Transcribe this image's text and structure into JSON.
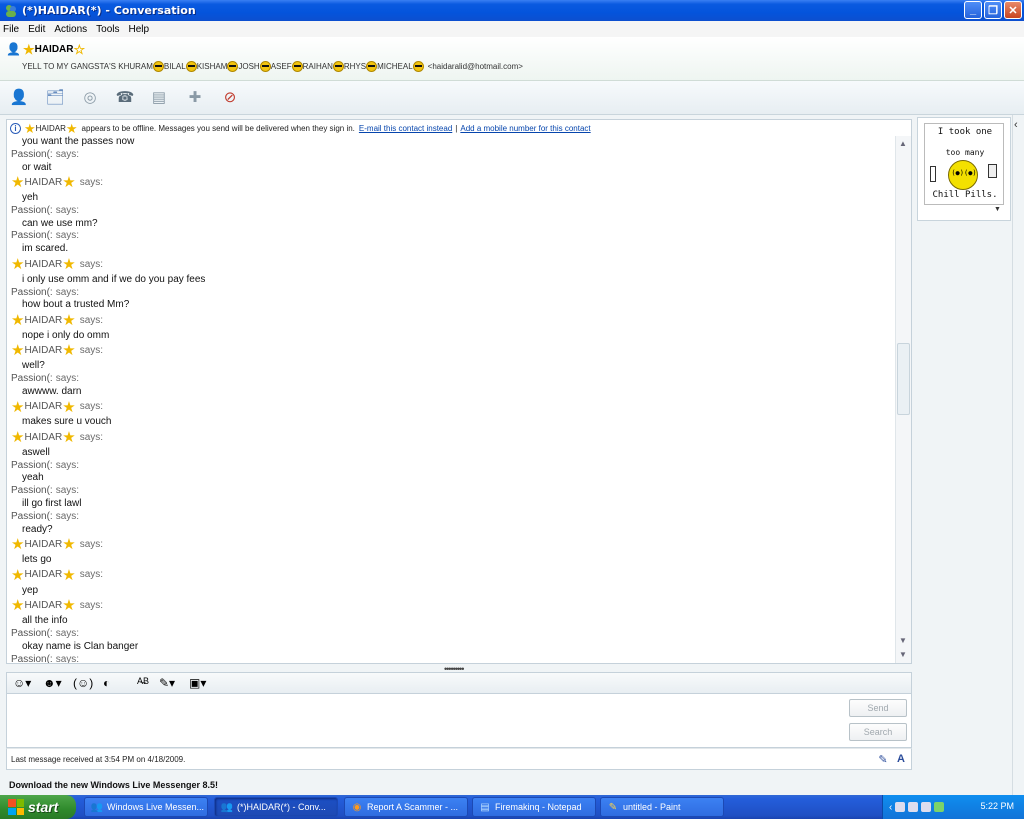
{
  "window": {
    "title": "(*)HAIDAR(*) - Conversation"
  },
  "menu": [
    "File",
    "Edit",
    "Actions",
    "Tools",
    "Help"
  ],
  "contact": {
    "display_name": "HAIDAR",
    "personal_message_parts": [
      "YELL TO MY GANGSTA'S KHURAM",
      "BILAL",
      "KISHAM",
      "JOSH",
      "ASEF",
      "RAIHAN",
      "RHYS",
      "MICHEAL",
      "<haidaralid@hotmail.com>"
    ]
  },
  "toolbar_icons": [
    "invite-icon",
    "share-files-icon",
    "video-call-icon",
    "call-icon",
    "games-icon",
    "activities-icon",
    "block-icon"
  ],
  "infobar": {
    "name": "HAIDAR",
    "text": "appears to be offline. Messages you send will be delivered when they sign in.",
    "link_email": "E-mail this contact instead",
    "separator": "|",
    "link_mobile": "Add a mobile number for this contact"
  },
  "conversation": [
    {
      "type": "msg",
      "text": "you want the passes now"
    },
    {
      "type": "says",
      "who": "Passion(:",
      "label": "says:"
    },
    {
      "type": "msg",
      "text": "or wait"
    },
    {
      "type": "says_h",
      "who": "HAIDAR",
      "label": "says:"
    },
    {
      "type": "msg",
      "text": "yeh"
    },
    {
      "type": "says",
      "who": "Passion(:",
      "label": "says:"
    },
    {
      "type": "msg",
      "text": "can we use mm?"
    },
    {
      "type": "says",
      "who": "Passion(:",
      "label": "says:"
    },
    {
      "type": "msg",
      "text": "im scared."
    },
    {
      "type": "says_h",
      "who": "HAIDAR",
      "label": "says:"
    },
    {
      "type": "msg",
      "text": "i only use omm and if we do you pay fees"
    },
    {
      "type": "says",
      "who": "Passion(:",
      "label": "says:"
    },
    {
      "type": "msg",
      "text": "how bout a trusted Mm?"
    },
    {
      "type": "says_h",
      "who": "HAIDAR",
      "label": "says:"
    },
    {
      "type": "msg",
      "text": "nope i only do omm"
    },
    {
      "type": "says_h",
      "who": "HAIDAR",
      "label": "says:"
    },
    {
      "type": "msg",
      "text": "well?"
    },
    {
      "type": "says",
      "who": "Passion(:",
      "label": "says:"
    },
    {
      "type": "msg",
      "text": "awwww. darn"
    },
    {
      "type": "says_h",
      "who": "HAIDAR",
      "label": "says:"
    },
    {
      "type": "msg",
      "text": "makes sure u vouch"
    },
    {
      "type": "says_h",
      "who": "HAIDAR",
      "label": "says:"
    },
    {
      "type": "msg",
      "text": "aswell"
    },
    {
      "type": "says",
      "who": "Passion(:",
      "label": "says:"
    },
    {
      "type": "msg",
      "text": "yeah"
    },
    {
      "type": "says",
      "who": "Passion(:",
      "label": "says:"
    },
    {
      "type": "msg",
      "text": "ill go first lawl"
    },
    {
      "type": "says",
      "who": "Passion(:",
      "label": "says:"
    },
    {
      "type": "msg",
      "text": "ready?"
    },
    {
      "type": "says_h",
      "who": "HAIDAR",
      "label": "says:"
    },
    {
      "type": "msg",
      "text": "lets go"
    },
    {
      "type": "says_h",
      "who": "HAIDAR",
      "label": "says:"
    },
    {
      "type": "msg",
      "text": "yep"
    },
    {
      "type": "says_h",
      "who": "HAIDAR",
      "label": "says:"
    },
    {
      "type": "msg",
      "text": "all the info"
    },
    {
      "type": "says",
      "who": "Passion(:",
      "label": "says:"
    },
    {
      "type": "msg",
      "text": "okay name is Clan banger"
    },
    {
      "type": "says",
      "who": "Passion(:",
      "label": "says:"
    }
  ],
  "input": {
    "send_label": "Send",
    "search_label": "Search",
    "value": ""
  },
  "status": {
    "last_message": "Last message received at 3:54 PM on 4/18/2009."
  },
  "download_banner": "Download the new Windows Live Messenger 8.5!",
  "display_picture": {
    "line1": "I took one",
    "line2": "too many",
    "line3": "Chill Pills."
  },
  "taskbar": {
    "start_label": "start",
    "tasks": [
      {
        "label": "Windows Live Messen...",
        "icon": "messenger-icon"
      },
      {
        "label": "(*)HAIDAR(*) - Conv...",
        "icon": "conversation-icon"
      },
      {
        "label": "Report A Scammer - ...",
        "icon": "firefox-icon"
      },
      {
        "label": "Firemakinq - Notepad",
        "icon": "notepad-icon"
      },
      {
        "label": "untitled - Paint",
        "icon": "paint-icon"
      }
    ],
    "clock": "5:22 PM"
  }
}
